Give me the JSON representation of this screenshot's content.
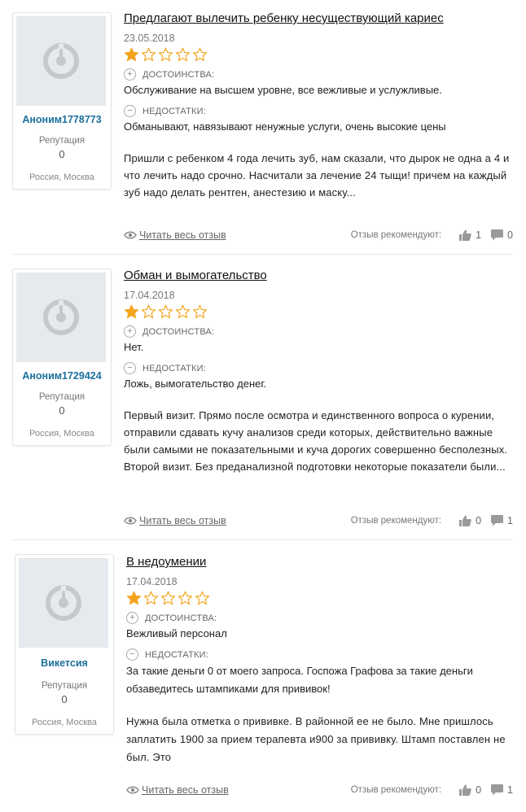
{
  "common": {
    "pros_label": "ДОСТОИНСТВА:",
    "cons_label": "НЕДОСТАТКИ:",
    "reputation_label": "Репутация",
    "read_more_label": "Читать весь отзыв",
    "recommend_label": "Отзыв рекомендуют:",
    "icons": [
      "avatar-placeholder-icon",
      "star-icon",
      "plus-circle-icon",
      "minus-circle-icon",
      "eye-icon",
      "thumbs-up-icon",
      "comment-icon"
    ],
    "colors": {
      "star": "#f3a41d",
      "username": "#1b6f9b",
      "icon_gray": "#9a9a9a"
    }
  },
  "reviews": [
    {
      "username": "Аноним1778773",
      "reputation": "0",
      "location": "Россия, Москва",
      "title": "Предлагают вылечить ребенку несуществующий кариес",
      "date": "23.05.2018",
      "rating": 1,
      "rating_max": 5,
      "pros": "Обслуживание на высшем уровне, все вежливые и услужливые.",
      "cons": "Обманывают, навязывают ненужные услуги, очень высокие цены",
      "body": "Пришли с ребенком 4 года лечить зуб, нам сказали, что дырок не одна а 4 и что лечить надо срочно. Насчитали за лечение 24 тыщи! причем на каждый зуб надо делать рентген, анестезию и маску...",
      "likes": "1",
      "comments": "0"
    },
    {
      "username": "Аноним1729424",
      "reputation": "0",
      "location": "Россия, Москва",
      "title": "Обман и вымогательство",
      "date": "17.04.2018",
      "rating": 1,
      "rating_max": 5,
      "pros": "Нет.",
      "cons": "Ложь, вымогательство денег.",
      "body": "Первый визит. Прямо после осмотра и единственного вопроса о курении, отправили сдавать кучу анализов среди которых, действительно важные были самыми не показательными и куча дорогих совершенно бесполезных. Второй визит. Без преданализной подготовки некоторые показатели были...",
      "likes": "0",
      "comments": "1"
    },
    {
      "username": "Викетсия",
      "reputation": "0",
      "location": "Россия, Москва",
      "title": "В недоумении",
      "date": "17.04.2018",
      "rating": 1,
      "rating_max": 5,
      "pros": "Вежливый персонал",
      "cons": "За такие деньги 0 от моего запроса. Госпожа Графова за такие деньги обзаведитесь штампиками для прививок!",
      "body": "Нужна была отметка о прививке. В районной ее не было. Мне пришлось заплатить 1900 за прием терапевта и900 за прививку. Штамп поставлен не был. Это",
      "likes": "0",
      "comments": "1"
    }
  ]
}
